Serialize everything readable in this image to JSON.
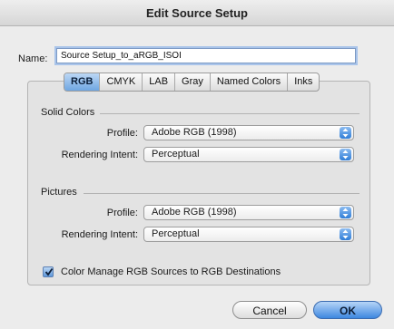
{
  "window": {
    "title": "Edit Source Setup"
  },
  "name_field": {
    "label": "Name:",
    "value": "Source Setup_to_aRGB_ISOI"
  },
  "tabs": [
    {
      "label": "RGB",
      "selected": true
    },
    {
      "label": "CMYK",
      "selected": false
    },
    {
      "label": "LAB",
      "selected": false
    },
    {
      "label": "Gray",
      "selected": false
    },
    {
      "label": "Named Colors",
      "selected": false
    },
    {
      "label": "Inks",
      "selected": false
    }
  ],
  "solid_colors": {
    "title": "Solid Colors",
    "profile_label": "Profile:",
    "profile_value": "Adobe RGB (1998)",
    "intent_label": "Rendering Intent:",
    "intent_value": "Perceptual"
  },
  "pictures": {
    "title": "Pictures",
    "profile_label": "Profile:",
    "profile_value": "Adobe RGB (1998)",
    "intent_label": "Rendering Intent:",
    "intent_value": "Perceptual"
  },
  "color_manage": {
    "label": "Color Manage RGB Sources to RGB Destinations",
    "checked": true
  },
  "buttons": {
    "cancel": "Cancel",
    "ok": "OK"
  },
  "colors": {
    "accent": "#3d88e0",
    "dialog_bg": "#ececec",
    "focus_ring": "#a9c4ea"
  },
  "icons": {
    "popup_arrows": "up-down-arrows-icon",
    "check": "checkmark-icon"
  }
}
